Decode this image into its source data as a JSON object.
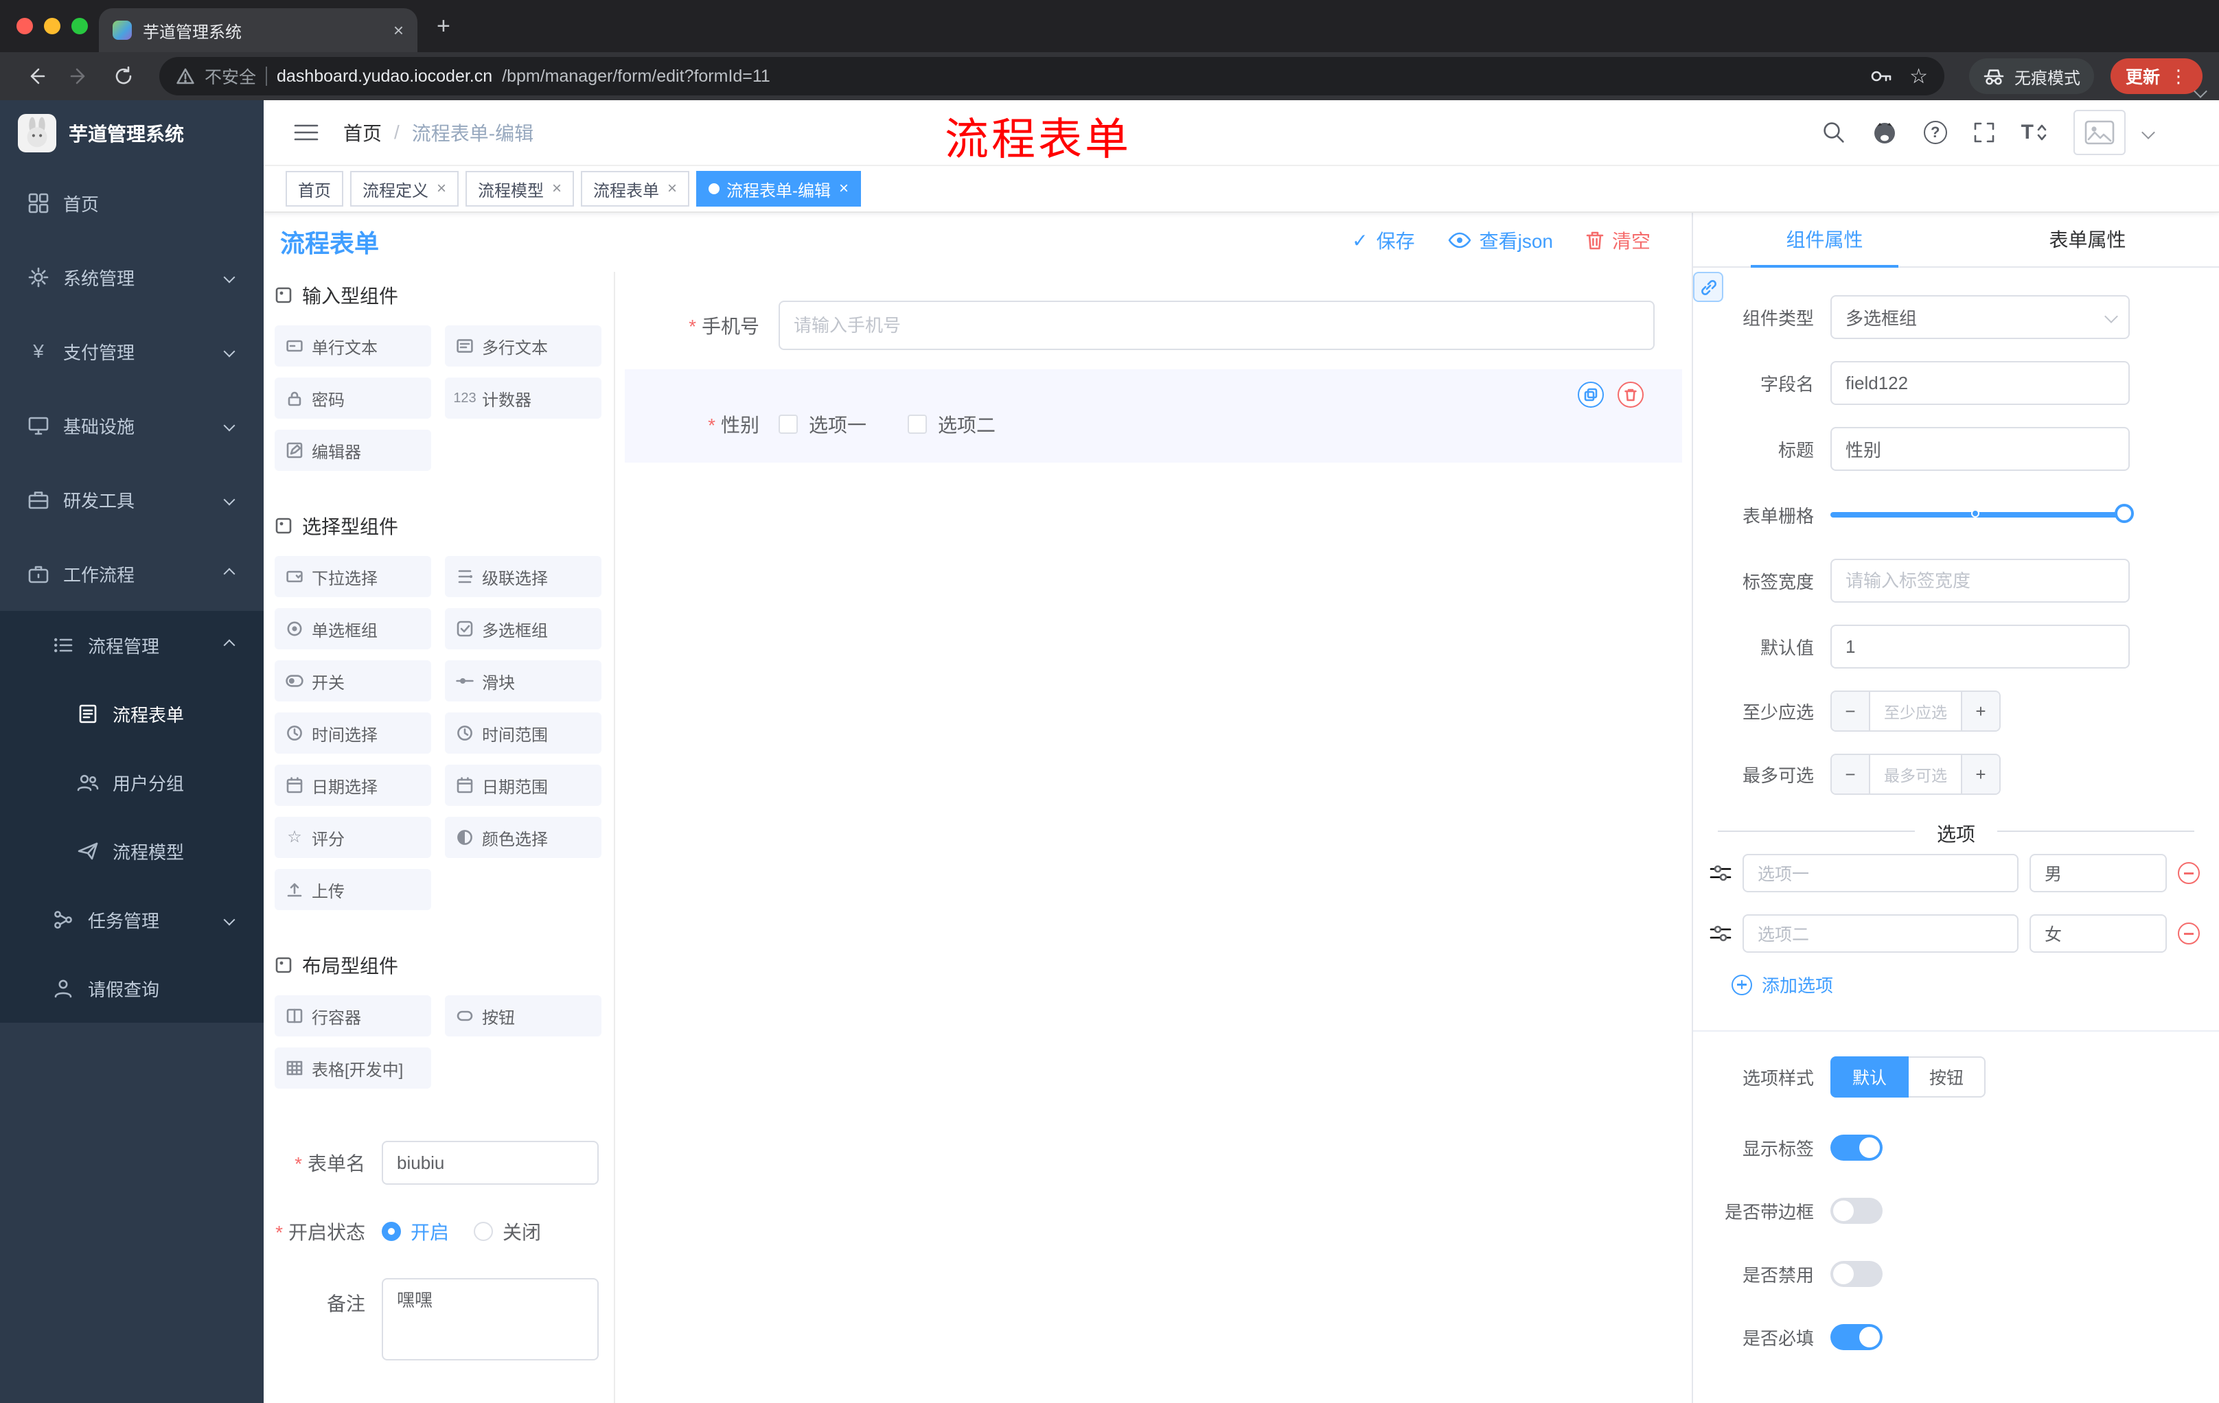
{
  "colors": {
    "primary": "#409EFF",
    "danger": "#F56C6C",
    "annotation": "#FF0000",
    "sidebar_bg": "#2D3A4B",
    "submenu_bg": "#1F2D3D",
    "update_button_bg": "#D04437"
  },
  "icons": {
    "close": "×",
    "plus": "+",
    "check": "✓",
    "more": "⋮",
    "question": "?",
    "yen": "¥",
    "counter": "123",
    "rate": "☆",
    "font_size": "T",
    "minus": "−"
  },
  "browser": {
    "tab_title": "芋道管理系统",
    "security_label": "不安全",
    "url_domain": "dashboard.yudao.iocoder.cn",
    "url_path": "/bpm/manager/form/edit?formId=11",
    "incognito_label": "无痕模式",
    "update_label": "更新"
  },
  "sidebar": {
    "logo_title": "芋道管理系统",
    "items": [
      {
        "label": "首页"
      },
      {
        "label": "系统管理"
      },
      {
        "label": "支付管理"
      },
      {
        "label": "基础设施"
      },
      {
        "label": "研发工具"
      },
      {
        "label": "工作流程"
      },
      {
        "label": "流程管理"
      },
      {
        "label": "流程表单"
      },
      {
        "label": "用户分组"
      },
      {
        "label": "流程模型"
      },
      {
        "label": "任务管理"
      },
      {
        "label": "请假查询"
      }
    ]
  },
  "header": {
    "breadcrumb_home": "首页",
    "breadcrumb_sep": "/",
    "breadcrumb_current": "流程表单-编辑",
    "annotation": "流程表单"
  },
  "tags": [
    {
      "label": "首页"
    },
    {
      "label": "流程定义"
    },
    {
      "label": "流程模型"
    },
    {
      "label": "流程表单"
    },
    {
      "label": "流程表单-编辑"
    }
  ],
  "page": {
    "title": "流程表单",
    "save": "保存",
    "view_json": "查看json",
    "clear": "清空"
  },
  "palette": {
    "sections": [
      {
        "title": "输入型组件",
        "items": [
          "单行文本",
          "多行文本",
          "密码",
          "计数器",
          "编辑器"
        ]
      },
      {
        "title": "选择型组件",
        "items": [
          "下拉选择",
          "级联选择",
          "单选框组",
          "多选框组",
          "开关",
          "滑块",
          "时间选择",
          "时间范围",
          "日期选择",
          "日期范围",
          "评分",
          "颜色选择",
          "上传"
        ]
      },
      {
        "title": "布局型组件",
        "items": [
          "行容器",
          "按钮",
          "表格[开发中]"
        ]
      }
    ],
    "form": {
      "name_label": "表单名",
      "name_value": "biubiu",
      "status_label": "开启状态",
      "status_on": "开启",
      "status_off": "关闭",
      "remark_label": "备注",
      "remark_value": "嘿嘿"
    }
  },
  "canvas": {
    "phone_label": "手机号",
    "phone_placeholder": "请输入手机号",
    "gender_label": "性别",
    "gender_options": [
      "选项一",
      "选项二"
    ]
  },
  "props": {
    "tab_component": "组件属性",
    "tab_form": "表单属性",
    "type_label": "组件类型",
    "type_value": "多选框组",
    "field_label": "字段名",
    "field_value": "field122",
    "title_label": "标题",
    "title_value": "性别",
    "grid_label": "表单栅格",
    "label_width_label": "标签宽度",
    "label_width_placeholder": "请输入标签宽度",
    "default_label": "默认值",
    "default_value": "1",
    "min_label": "至少应选",
    "min_placeholder": "至少应选",
    "max_label": "最多可选",
    "max_placeholder": "最多可选",
    "options_divider": "选项",
    "options": [
      {
        "label": "选项一",
        "value": "男"
      },
      {
        "label": "选项二",
        "value": "女"
      }
    ],
    "add_option": "添加选项",
    "style_label": "选项样式",
    "style_default": "默认",
    "style_button": "按钮",
    "style_selected": "默认",
    "switches": [
      {
        "label": "显示标签",
        "on": true
      },
      {
        "label": "是否带边框",
        "on": false
      },
      {
        "label": "是否禁用",
        "on": false
      },
      {
        "label": "是否必填",
        "on": true
      }
    ]
  }
}
